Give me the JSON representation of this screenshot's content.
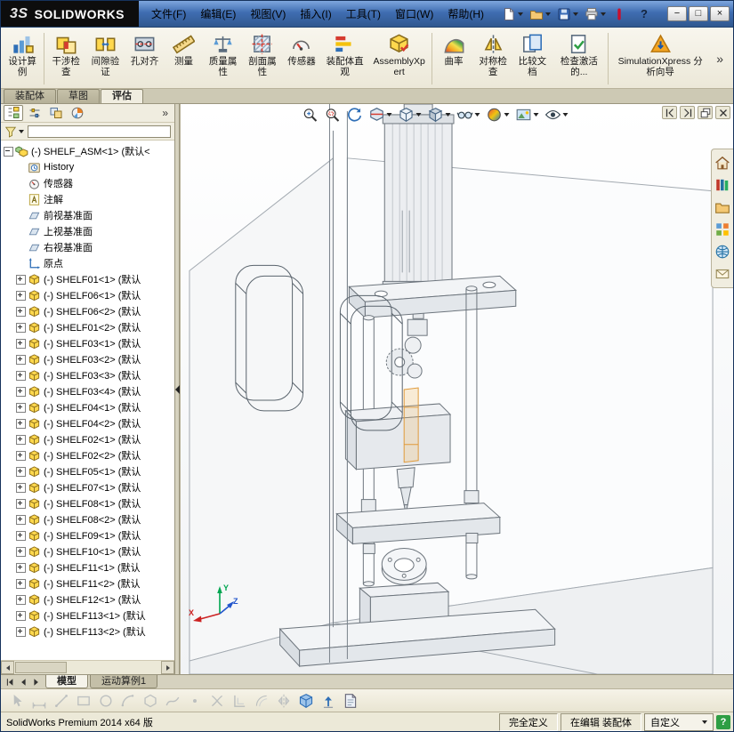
{
  "colors": {
    "titlebar_blue": "#3f6db1",
    "ribbon_bg": "#f0ede1",
    "selection_orange": "#e09a3a",
    "status_green": "#2e9e44",
    "logo_red": "#c8102e"
  },
  "window": {
    "logo_mark": "3S",
    "logo_text": "SOLIDWORKS",
    "help_label": "?",
    "menus": [
      {
        "name": "menu-file",
        "label": "文件(F)"
      },
      {
        "name": "menu-edit",
        "label": "编辑(E)"
      },
      {
        "name": "menu-view",
        "label": "视图(V)"
      },
      {
        "name": "menu-insert",
        "label": "插入(I)"
      },
      {
        "name": "menu-tools",
        "label": "工具(T)"
      },
      {
        "name": "menu-window",
        "label": "窗口(W)"
      },
      {
        "name": "menu-help",
        "label": "帮助(H)"
      }
    ],
    "quick_icons": [
      {
        "name": "new-document-icon",
        "sym": "new-doc",
        "dd": true
      },
      {
        "name": "open-icon",
        "sym": "open",
        "dd": true
      },
      {
        "name": "save-icon",
        "sym": "save",
        "dd": true
      },
      {
        "name": "print-icon",
        "sym": "print",
        "dd": true
      },
      {
        "name": "solidworks-resources-icon",
        "sym": "red-pill"
      }
    ],
    "controls": {
      "minimize": "−",
      "maximize": "□",
      "close": "×"
    }
  },
  "ribbon": {
    "more": "»",
    "buttons": [
      {
        "name": "design-study-button",
        "label": "设计算例",
        "sym": "r-design-study",
        "divider_after": true
      },
      {
        "name": "interference-detection-button",
        "label": "干涉检查",
        "sym": "r-interference"
      },
      {
        "name": "clearance-verification-button",
        "label": "间隙验证",
        "sym": "r-clearance"
      },
      {
        "name": "hole-alignment-button",
        "label": "孔对齐",
        "sym": "r-hole"
      },
      {
        "name": "measure-button",
        "label": "测量",
        "sym": "r-measure"
      },
      {
        "name": "mass-properties-button",
        "label": "质量属性",
        "sym": "r-mass"
      },
      {
        "name": "section-properties-button",
        "label": "剖面属性",
        "sym": "r-sectionp"
      },
      {
        "name": "sensor-button",
        "label": "传感器",
        "sym": "r-sensor"
      },
      {
        "name": "assembly-visualization-button",
        "label": "装配体直观",
        "sym": "r-assemvis"
      },
      {
        "name": "assemblyxpert-button",
        "label": "AssemblyXpert",
        "sym": "r-axpert",
        "wide": true,
        "divider_after": true
      },
      {
        "name": "curvature-button",
        "label": "曲率",
        "sym": "r-curvature"
      },
      {
        "name": "symmetry-check-button",
        "label": "对称检查",
        "sym": "r-symmetry"
      },
      {
        "name": "compare-documents-button",
        "label": "比较文档",
        "sym": "r-compare"
      },
      {
        "name": "check-active-document-button",
        "label": "检查激活的...",
        "sym": "r-checkdoc",
        "divider_after": true
      },
      {
        "name": "simulationxpress-button",
        "label": "SimulationXpress 分析向导",
        "sym": "r-simx",
        "wide": true
      }
    ]
  },
  "command_tabs": [
    {
      "name": "tab-assembly",
      "label": "装配体"
    },
    {
      "name": "tab-sketch",
      "label": "草图"
    },
    {
      "name": "tab-evaluate",
      "label": "评估",
      "active": true
    }
  ],
  "panel": {
    "more": "»",
    "tabs": [
      {
        "name": "featuremanager-tab",
        "sym": "ftree",
        "active": true
      },
      {
        "name": "propertymanager-tab",
        "sym": "pm"
      },
      {
        "name": "configurationmanager-tab",
        "sym": "config"
      },
      {
        "name": "displaymanager-tab",
        "sym": "dm"
      }
    ],
    "rows": [
      {
        "label": "(-) SHELF_ASM<1> (默认<",
        "sym": "assembly",
        "minus": true
      },
      {
        "label": "History",
        "sym": "history",
        "indent": true
      },
      {
        "label": "传感器",
        "sym": "sensor",
        "indent": true
      },
      {
        "label": "注解",
        "sym": "annotation",
        "indent": true
      },
      {
        "label": "前视基准面",
        "sym": "plane",
        "indent": true
      },
      {
        "label": "上视基准面",
        "sym": "plane",
        "indent": true
      },
      {
        "label": "右视基准面",
        "sym": "plane",
        "indent": true
      },
      {
        "label": "原点",
        "sym": "origin",
        "indent": true
      },
      {
        "label": "(-) SHELF01<1> (默认",
        "sym": "part",
        "indent": true,
        "plus": true
      },
      {
        "label": "(-) SHELF06<1> (默认",
        "sym": "part",
        "indent": true,
        "plus": true
      },
      {
        "label": "(-) SHELF06<2> (默认",
        "sym": "part",
        "indent": true,
        "plus": true
      },
      {
        "label": "(-) SHELF01<2> (默认",
        "sym": "part",
        "indent": true,
        "plus": true
      },
      {
        "label": "(-) SHELF03<1> (默认",
        "sym": "part",
        "indent": true,
        "plus": true
      },
      {
        "label": "(-) SHELF03<2> (默认",
        "sym": "part",
        "indent": true,
        "plus": true
      },
      {
        "label": "(-) SHELF03<3> (默认",
        "sym": "part",
        "indent": true,
        "plus": true
      },
      {
        "label": "(-) SHELF03<4> (默认",
        "sym": "part",
        "indent": true,
        "plus": true
      },
      {
        "label": "(-) SHELF04<1> (默认",
        "sym": "part",
        "indent": true,
        "plus": true
      },
      {
        "label": "(-) SHELF04<2> (默认",
        "sym": "part",
        "indent": true,
        "plus": true
      },
      {
        "label": "(-) SHELF02<1> (默认",
        "sym": "part",
        "indent": true,
        "plus": true
      },
      {
        "label": "(-) SHELF02<2> (默认",
        "sym": "part",
        "indent": true,
        "plus": true
      },
      {
        "label": "(-) SHELF05<1> (默认",
        "sym": "part",
        "indent": true,
        "plus": true
      },
      {
        "label": "(-) SHELF07<1> (默认",
        "sym": "part",
        "indent": true,
        "plus": true
      },
      {
        "label": "(-) SHELF08<1> (默认",
        "sym": "part",
        "indent": true,
        "plus": true
      },
      {
        "label": "(-) SHELF08<2> (默认",
        "sym": "part",
        "indent": true,
        "plus": true
      },
      {
        "label": "(-) SHELF09<1> (默认",
        "sym": "part",
        "indent": true,
        "plus": true
      },
      {
        "label": "(-) SHELF10<1> (默认",
        "sym": "part",
        "indent": true,
        "plus": true
      },
      {
        "label": "(-) SHELF11<1> (默认",
        "sym": "part",
        "indent": true,
        "plus": true
      },
      {
        "label": "(-) SHELF11<2> (默认",
        "sym": "part",
        "indent": true,
        "plus": true
      },
      {
        "label": "(-) SHELF12<1> (默认",
        "sym": "part",
        "indent": true,
        "plus": true
      },
      {
        "label": "(-) SHELF113<1> (默认",
        "sym": "part",
        "indent": true,
        "plus": true
      },
      {
        "label": "(-) SHELF113<2> (默认",
        "sym": "part",
        "indent": true,
        "plus": true
      }
    ]
  },
  "viewport": {
    "hud": [
      {
        "name": "zoom-fit-icon",
        "sym": "zoom-fit"
      },
      {
        "name": "zoom-area-icon",
        "sym": "zoom-area"
      },
      {
        "name": "previous-view-icon",
        "sym": "prev-view"
      },
      {
        "name": "section-view-icon",
        "sym": "section",
        "dd": true
      },
      {
        "name": "view-orientation-icon",
        "sym": "vieworient",
        "dd": true
      },
      {
        "name": "display-style-icon",
        "sym": "dispstyle",
        "dd": true
      },
      {
        "name": "hide-show-items-icon",
        "sym": "glasses",
        "dd": true
      },
      {
        "name": "edit-appearance-icon",
        "sym": "ball",
        "dd": true
      },
      {
        "name": "apply-scene-icon",
        "sym": "scene",
        "dd": true
      },
      {
        "name": "view-settings-icon",
        "sym": "eye",
        "dd": true
      }
    ],
    "doc_controls": [
      {
        "name": "pane-collapse-left-icon",
        "sym": "collapse-left"
      },
      {
        "name": "pane-collapse-right-icon",
        "sym": "collapse-right"
      },
      {
        "name": "doc-restore-icon",
        "sym": "restore"
      },
      {
        "name": "doc-close-icon",
        "sym": "close-x"
      }
    ],
    "taskpane": [
      {
        "name": "home-icon",
        "sym": "home"
      },
      {
        "name": "design-library-icon",
        "sym": "library"
      },
      {
        "name": "file-explorer-icon",
        "sym": "folder"
      },
      {
        "name": "view-palette-icon",
        "sym": "palette"
      },
      {
        "name": "appearances-scenes-icon",
        "sym": "globe"
      },
      {
        "name": "custom-properties-icon",
        "sym": "mail"
      }
    ],
    "triad": {
      "x": "X",
      "y": "Y",
      "z": "Z"
    }
  },
  "bottom": {
    "nav": [
      {
        "name": "first-tab-icon",
        "sym": "nav-first"
      },
      {
        "name": "prev-tab-icon",
        "sym": "nav-prev"
      },
      {
        "name": "next-tab-icon",
        "sym": "nav-next"
      }
    ],
    "tabs": [
      {
        "name": "model-tab",
        "label": "模型",
        "active": true
      },
      {
        "name": "motion-study-tab",
        "label": "运动算例1"
      }
    ]
  },
  "sketch_bar": [
    {
      "name": "select-icon",
      "sym": "cursor"
    },
    {
      "name": "smart-dimension-icon",
      "sym": "dim"
    },
    {
      "name": "line-icon",
      "sym": "line"
    },
    {
      "name": "rectangle-icon",
      "sym": "rect"
    },
    {
      "name": "circle-icon",
      "sym": "circle"
    },
    {
      "name": "arc-icon",
      "sym": "arc"
    },
    {
      "name": "polygon-icon",
      "sym": "poly"
    },
    {
      "name": "spline-icon",
      "sym": "spline"
    },
    {
      "name": "point-icon",
      "sym": "point"
    },
    {
      "name": "trim-entities-icon",
      "sym": "trim"
    },
    {
      "name": "convert-entities-icon",
      "sym": "convert"
    },
    {
      "name": "offset-entities-icon",
      "sym": "offset"
    },
    {
      "name": "mirror-entities-icon",
      "sym": "mirror"
    },
    {
      "name": "view-cube-icon",
      "sym": "bluecube",
      "colored": true
    },
    {
      "name": "instant3d-icon",
      "sym": "uparrow",
      "colored": true
    },
    {
      "name": "sheet-icon",
      "sym": "sheet",
      "colored": true
    }
  ],
  "status": {
    "product": "SolidWorks Premium 2014 x64 版",
    "definition": "完全定义",
    "editing": "在编辑 装配体",
    "custom": "自定义",
    "help": "?"
  }
}
